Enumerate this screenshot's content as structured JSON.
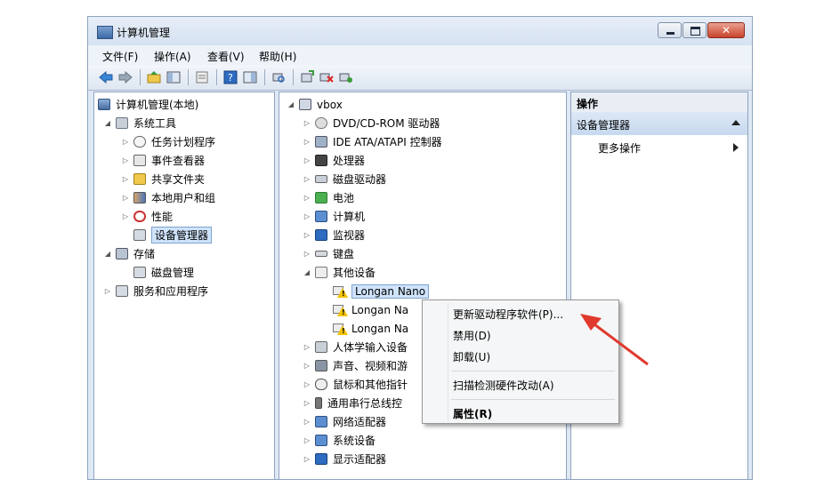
{
  "window": {
    "title": "计算机管理"
  },
  "menu": [
    "文件(F)",
    "操作(A)",
    "查看(V)",
    "帮助(H)"
  ],
  "left_tree": {
    "root": "计算机管理(本地)",
    "system_tools": "系统工具",
    "task_scheduler": "任务计划程序",
    "event_viewer": "事件查看器",
    "shared_folders": "共享文件夹",
    "local_users": "本地用户和组",
    "performance": "性能",
    "device_manager": "设备管理器",
    "storage": "存储",
    "disk_management": "磁盘管理",
    "services_apps": "服务和应用程序"
  },
  "device_tree": {
    "root": "vbox",
    "items": [
      "DVD/CD-ROM 驱动器",
      "IDE ATA/ATAPI 控制器",
      "处理器",
      "磁盘驱动器",
      "电池",
      "计算机",
      "监视器",
      "键盘",
      "其他设备"
    ],
    "other_devices": [
      "Longan Nano",
      "Longan Na",
      "Longan Na"
    ],
    "after_items": [
      "人体学输入设备",
      "声音、视频和游",
      "鼠标和其他指针",
      "通用串行总线控",
      "网络适配器",
      "系统设备",
      "显示适配器"
    ]
  },
  "actions": {
    "header": "操作",
    "section": "设备管理器",
    "more": "更多操作"
  },
  "context_menu": {
    "update_driver": "更新驱动程序软件(P)...",
    "disable": "禁用(D)",
    "uninstall": "卸载(U)",
    "scan": "扫描检测硬件改动(A)",
    "properties": "属性(R)"
  },
  "colors": {
    "annotation_arrow": "#e03a2f",
    "selection": "#cfe3fb"
  }
}
